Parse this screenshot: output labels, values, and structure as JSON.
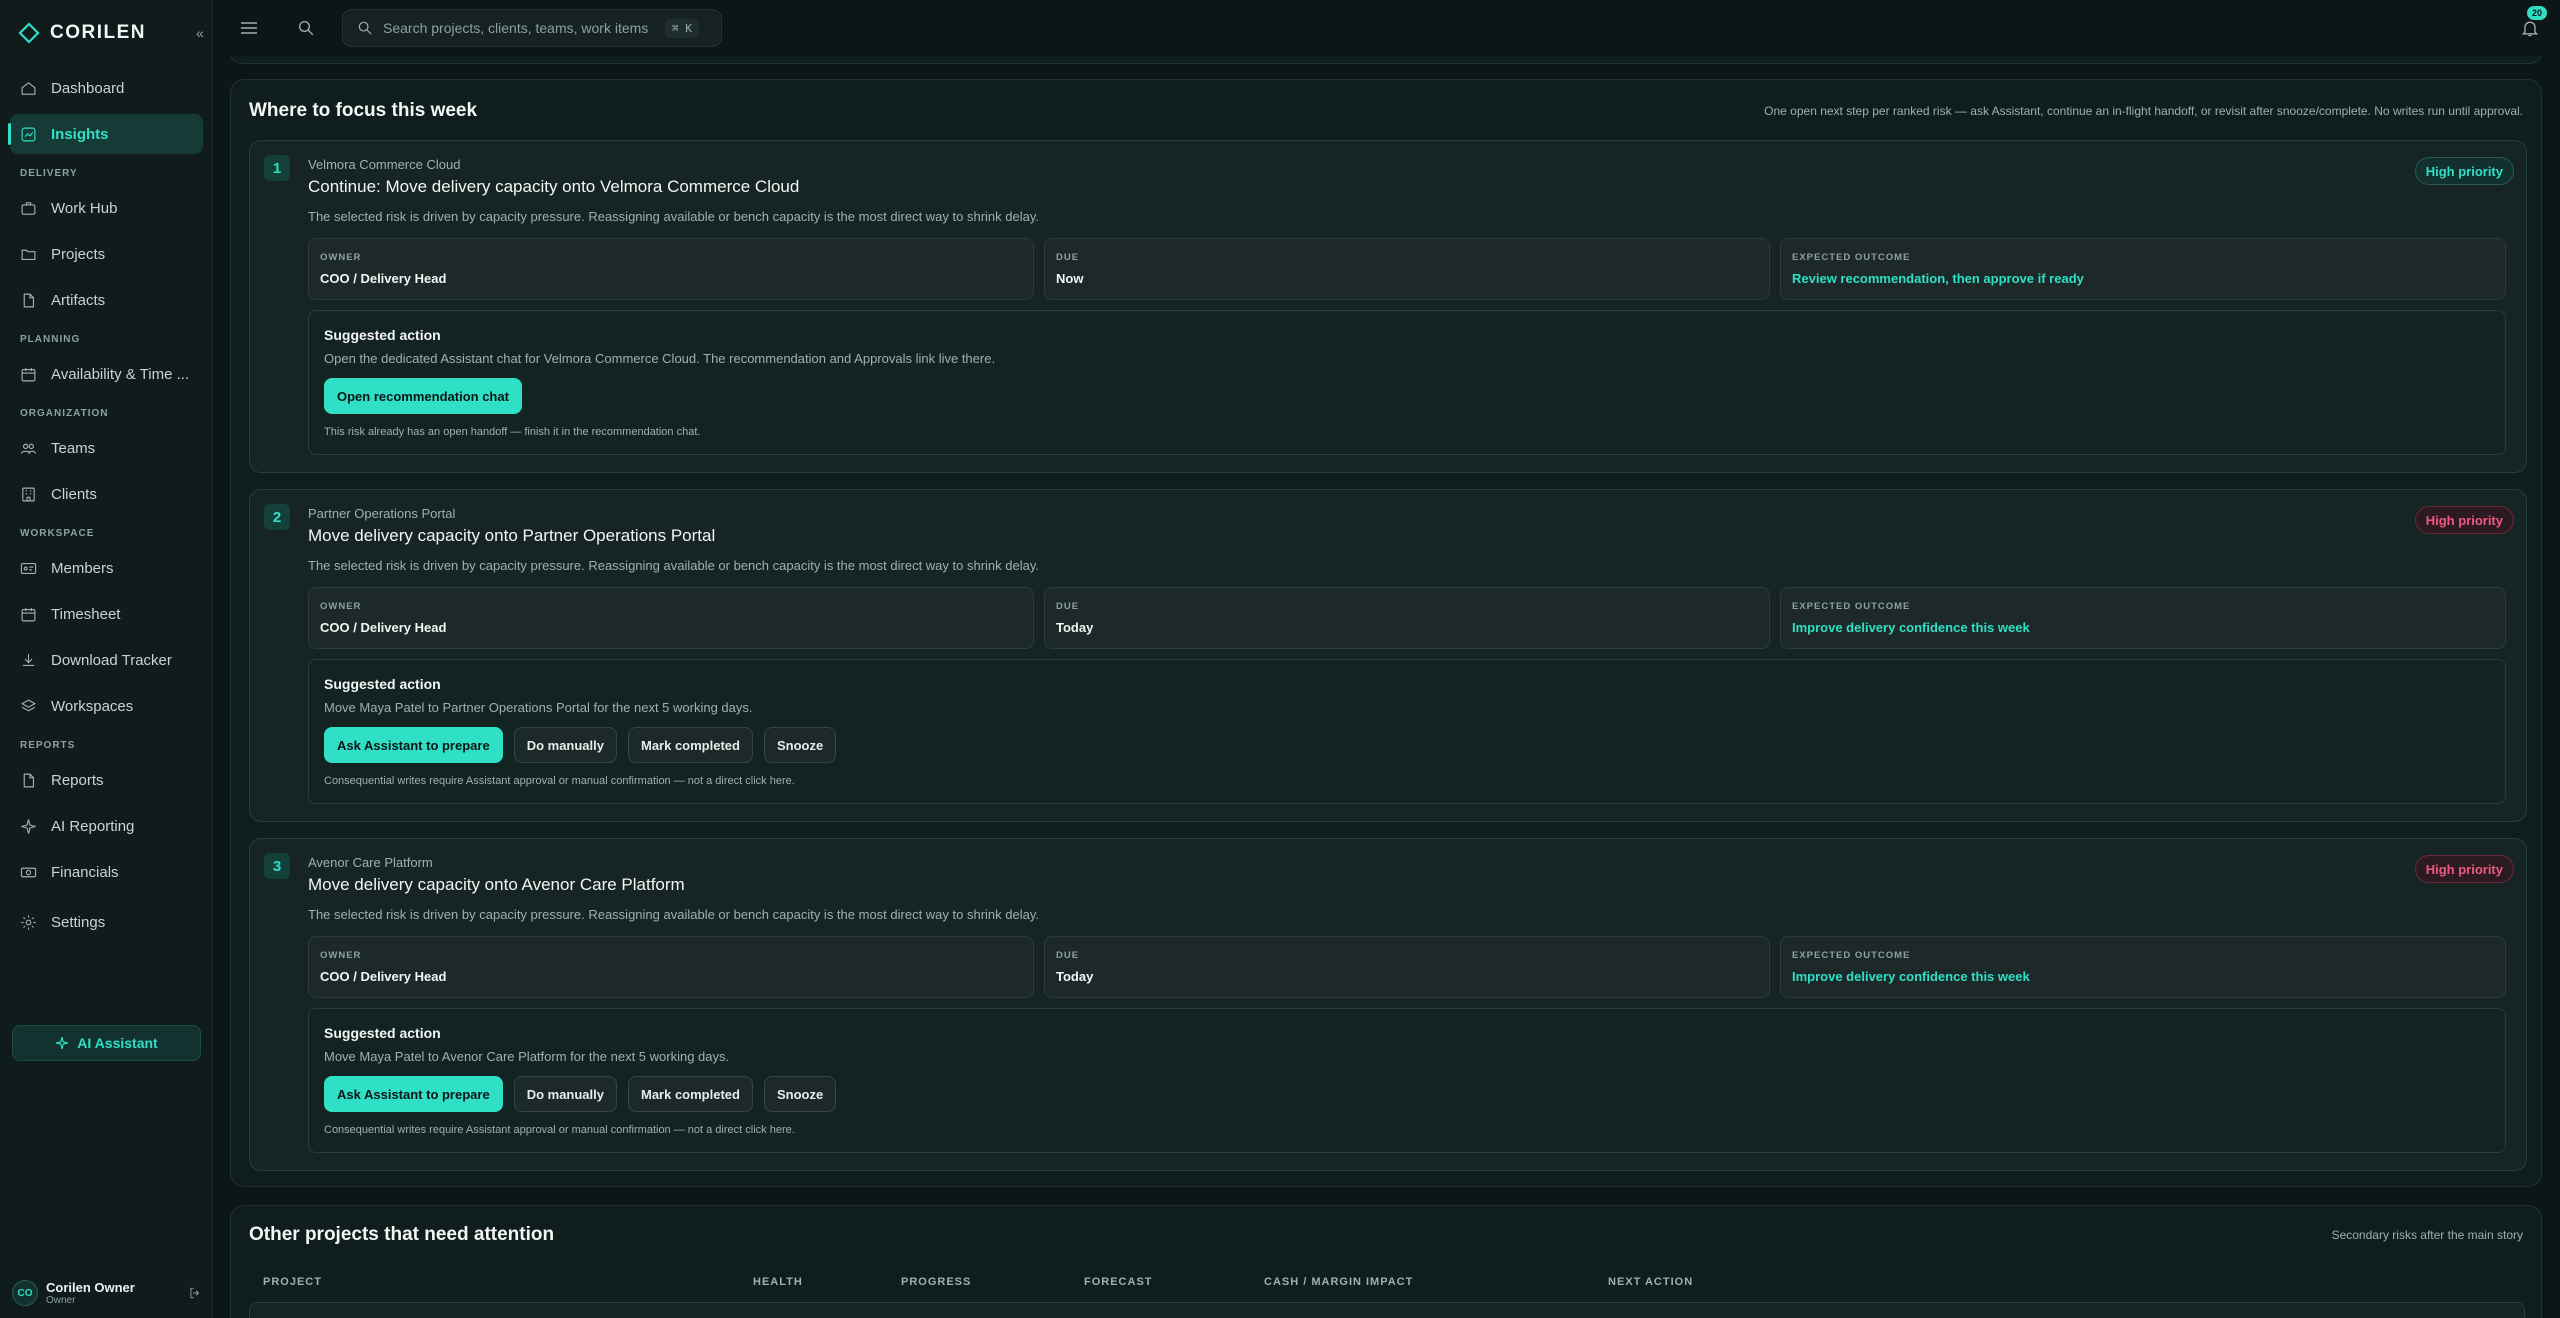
{
  "brand": {
    "name": "CORILEN"
  },
  "sidebar": {
    "items_top": [
      {
        "label": "Dashboard",
        "icon": "home-icon"
      },
      {
        "label": "Insights",
        "icon": "chart-icon",
        "active": true
      }
    ],
    "sections": [
      {
        "title": "DELIVERY",
        "items": [
          {
            "label": "Work Hub",
            "icon": "briefcase-icon"
          },
          {
            "label": "Projects",
            "icon": "folder-icon"
          },
          {
            "label": "Artifacts",
            "icon": "file-icon"
          }
        ]
      },
      {
        "title": "PLANNING",
        "items": [
          {
            "label": "Availability & Time ...",
            "icon": "calendar-icon"
          }
        ]
      },
      {
        "title": "ORGANIZATION",
        "items": [
          {
            "label": "Teams",
            "icon": "teams-icon"
          },
          {
            "label": "Clients",
            "icon": "building-icon"
          }
        ]
      },
      {
        "title": "WORKSPACE",
        "items": [
          {
            "label": "Members",
            "icon": "id-card-icon"
          },
          {
            "label": "Timesheet",
            "icon": "calendar-icon"
          },
          {
            "label": "Download Tracker",
            "icon": "download-icon"
          },
          {
            "label": "Workspaces",
            "icon": "layers-icon"
          }
        ]
      },
      {
        "title": "REPORTS",
        "items": [
          {
            "label": "Reports",
            "icon": "file-icon"
          },
          {
            "label": "AI Reporting",
            "icon": "sparkle-icon"
          },
          {
            "label": "Financials",
            "icon": "money-icon"
          }
        ]
      }
    ],
    "settings": {
      "label": "Settings",
      "icon": "gear-icon"
    },
    "ai_button": {
      "label": "AI Assistant"
    },
    "user": {
      "initials": "CO",
      "name": "Corilen Owner",
      "role": "Owner"
    }
  },
  "topbar": {
    "search_placeholder": "Search projects, clients, teams, work items",
    "shortcut": "⌘ K",
    "notification_count": "20"
  },
  "focus": {
    "title": "Where to focus this week",
    "note": "One open next step per ranked risk — ask Assistant, continue an in-flight handoff, or revisit after snooze/complete. No writes run until approval.",
    "field_labels": {
      "owner": "OWNER",
      "due": "DUE",
      "outcome": "EXPECTED OUTCOME"
    },
    "suggested_label": "Suggested action",
    "cards": [
      {
        "rank": "1",
        "project": "Velmora Commerce Cloud",
        "title": "Continue: Move delivery capacity onto Velmora Commerce Cloud",
        "description": "The selected risk is driven by capacity pressure. Reassigning available or bench capacity is the most direct way to shrink delay.",
        "priority": "High priority",
        "priority_style": "teal",
        "owner": "COO / Delivery Head",
        "due": "Now",
        "outcome": "Review recommendation, then approve if ready",
        "action_text": "Open the dedicated Assistant chat for Velmora Commerce Cloud. The recommendation and Approvals link live there.",
        "buttons": [
          {
            "label": "Open recommendation chat",
            "primary": true
          }
        ],
        "note": "This risk already has an open handoff — finish it in the recommendation chat."
      },
      {
        "rank": "2",
        "project": "Partner Operations Portal",
        "title": "Move delivery capacity onto Partner Operations Portal",
        "description": "The selected risk is driven by capacity pressure. Reassigning available or bench capacity is the most direct way to shrink delay.",
        "priority": "High priority",
        "priority_style": "red",
        "owner": "COO / Delivery Head",
        "due": "Today",
        "outcome": "Improve delivery confidence this week",
        "action_text": "Move Maya Patel to Partner Operations Portal for the next 5 working days.",
        "buttons": [
          {
            "label": "Ask Assistant to prepare",
            "primary": true
          },
          {
            "label": "Do manually",
            "primary": false
          },
          {
            "label": "Mark completed",
            "primary": false
          },
          {
            "label": "Snooze",
            "primary": false
          }
        ],
        "note": "Consequential writes require Assistant approval or manual confirmation — not a direct click here."
      },
      {
        "rank": "3",
        "project": "Avenor Care Platform",
        "title": "Move delivery capacity onto Avenor Care Platform",
        "description": "The selected risk is driven by capacity pressure. Reassigning available or bench capacity is the most direct way to shrink delay.",
        "priority": "High priority",
        "priority_style": "red",
        "owner": "COO / Delivery Head",
        "due": "Today",
        "outcome": "Improve delivery confidence this week",
        "action_text": "Move Maya Patel to Avenor Care Platform for the next 5 working days.",
        "buttons": [
          {
            "label": "Ask Assistant to prepare",
            "primary": true
          },
          {
            "label": "Do manually",
            "primary": false
          },
          {
            "label": "Mark completed",
            "primary": false
          },
          {
            "label": "Snooze",
            "primary": false
          }
        ],
        "note": "Consequential writes require Assistant approval or manual confirmation — not a direct click here."
      }
    ]
  },
  "other": {
    "title": "Other projects that need attention",
    "note": "Secondary risks after the main story",
    "columns": [
      "PROJECT",
      "HEALTH",
      "PROGRESS",
      "FORECAST",
      "CASH / MARGIN IMPACT",
      "NEXT ACTION"
    ]
  },
  "colors": {
    "accent": "#2fe0c6",
    "danger": "#f0597f",
    "background": "#0c1616"
  }
}
